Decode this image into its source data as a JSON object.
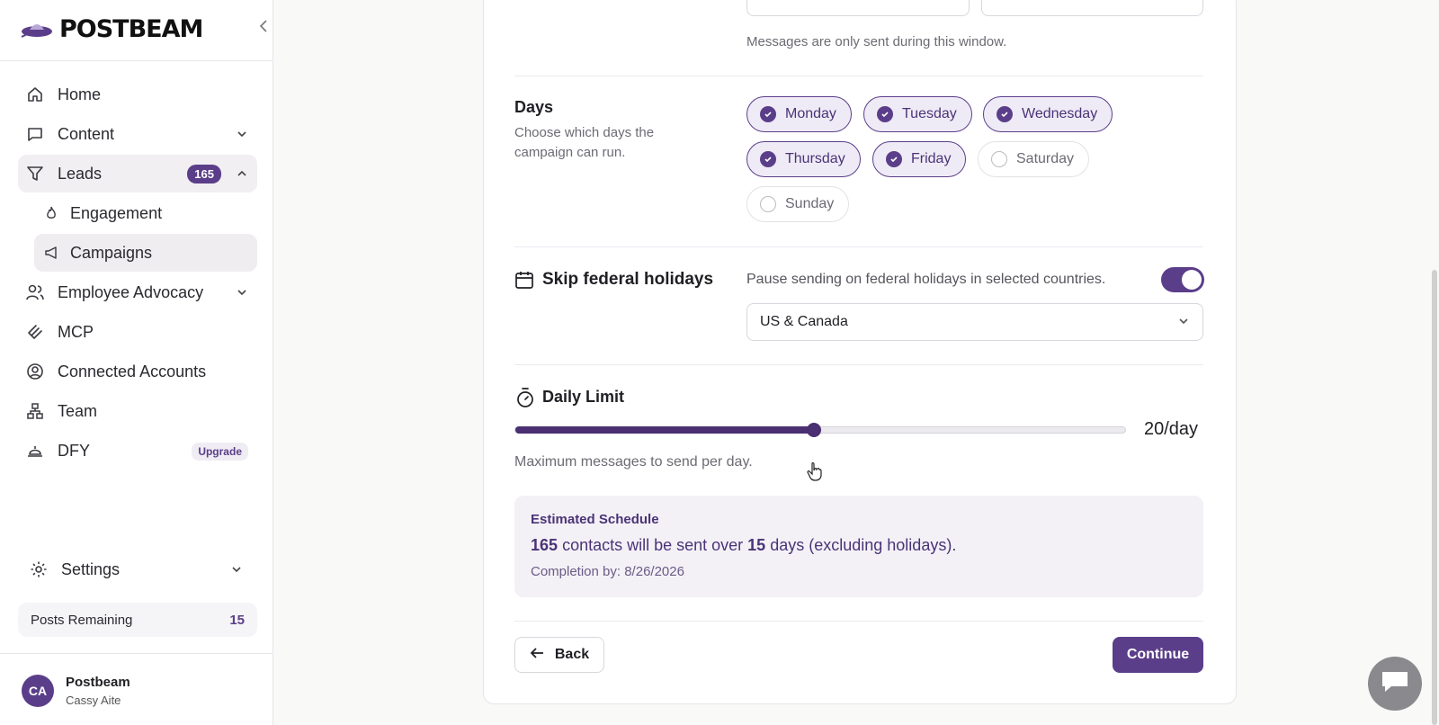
{
  "brand": {
    "name": "POSTBEAM"
  },
  "sidebar": {
    "items": [
      {
        "label": "Home",
        "icon": "home-icon"
      },
      {
        "label": "Content",
        "icon": "message-square-icon"
      },
      {
        "label": "Leads",
        "icon": "filter-icon",
        "badge": "165"
      },
      {
        "label": "Engagement",
        "icon": "flame-icon"
      },
      {
        "label": "Campaigns",
        "icon": "megaphone-icon"
      },
      {
        "label": "Employee Advocacy",
        "icon": "users-icon"
      },
      {
        "label": "MCP",
        "icon": "mcp-icon"
      },
      {
        "label": "Connected Accounts",
        "icon": "user-circle-icon"
      },
      {
        "label": "Team",
        "icon": "network-icon"
      },
      {
        "label": "DFY",
        "icon": "service-bell-icon",
        "badge": "Upgrade"
      }
    ],
    "settings_label": "Settings",
    "posts_remaining_label": "Posts Remaining",
    "posts_remaining_value": "15",
    "user": {
      "initials": "CA",
      "name": "Postbeam",
      "sub": "Cassy Aite"
    }
  },
  "form": {
    "window_helper": "Messages are only sent during this window.",
    "days": {
      "title": "Days",
      "description": "Choose which days the campaign can run.",
      "options": [
        {
          "label": "Monday",
          "checked": true
        },
        {
          "label": "Tuesday",
          "checked": true
        },
        {
          "label": "Wednesday",
          "checked": true
        },
        {
          "label": "Thursday",
          "checked": true
        },
        {
          "label": "Friday",
          "checked": true
        },
        {
          "label": "Saturday",
          "checked": false
        },
        {
          "label": "Sunday",
          "checked": false
        }
      ]
    },
    "holidays": {
      "title": "Skip federal holidays",
      "description": "Pause sending on federal holidays in selected countries.",
      "enabled": true,
      "region": "US & Canada"
    },
    "daily_limit": {
      "title": "Daily Limit",
      "value_label": "20/day",
      "fraction": 0.49,
      "helper": "Maximum messages to send per day."
    },
    "estimate": {
      "title": "Estimated Schedule",
      "contacts": "165",
      "text_1": "contacts will be sent over",
      "days": "15",
      "text_2": "days (excluding holidays).",
      "completion": "Completion by: 8/26/2026"
    },
    "back_label": "Back",
    "continue_label": "Continue"
  },
  "colors": {
    "accent": "#5b3e8a",
    "accent_light": "#efebf6"
  }
}
